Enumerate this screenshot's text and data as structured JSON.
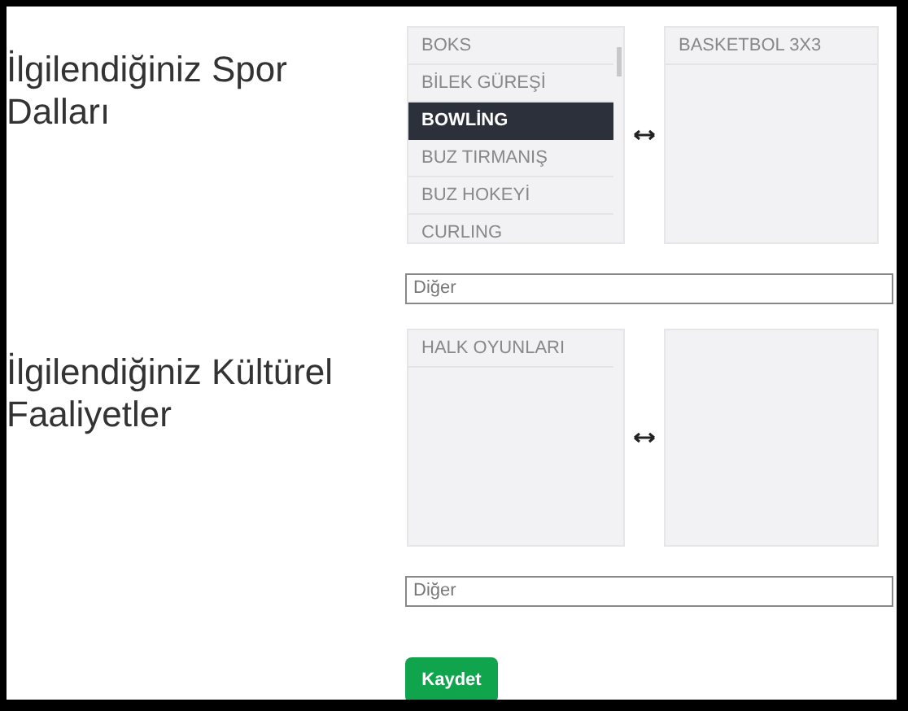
{
  "sections": [
    {
      "label": "İlgilendiğiniz Spor Dalları",
      "available": [
        {
          "text": "BOKS",
          "selected": false
        },
        {
          "text": "BİLEK GÜREŞİ",
          "selected": false
        },
        {
          "text": "BOWLİNG",
          "selected": true
        },
        {
          "text": "BUZ TIRMANIŞ",
          "selected": false
        },
        {
          "text": "BUZ HOKEYİ",
          "selected": false
        },
        {
          "text": "CURLING",
          "selected": false
        }
      ],
      "scrollable": true,
      "chosen": [
        {
          "text": "BASKETBOL 3X3"
        }
      ],
      "other": {
        "placeholder": "Diğer"
      }
    },
    {
      "label": "İlgilendiğiniz Kültürel Faaliyetler",
      "available": [
        {
          "text": "HALK OYUNLARI",
          "selected": false
        }
      ],
      "scrollable": false,
      "other": {
        "placeholder": "Diğer"
      }
    }
  ],
  "save_button": "Kaydet"
}
